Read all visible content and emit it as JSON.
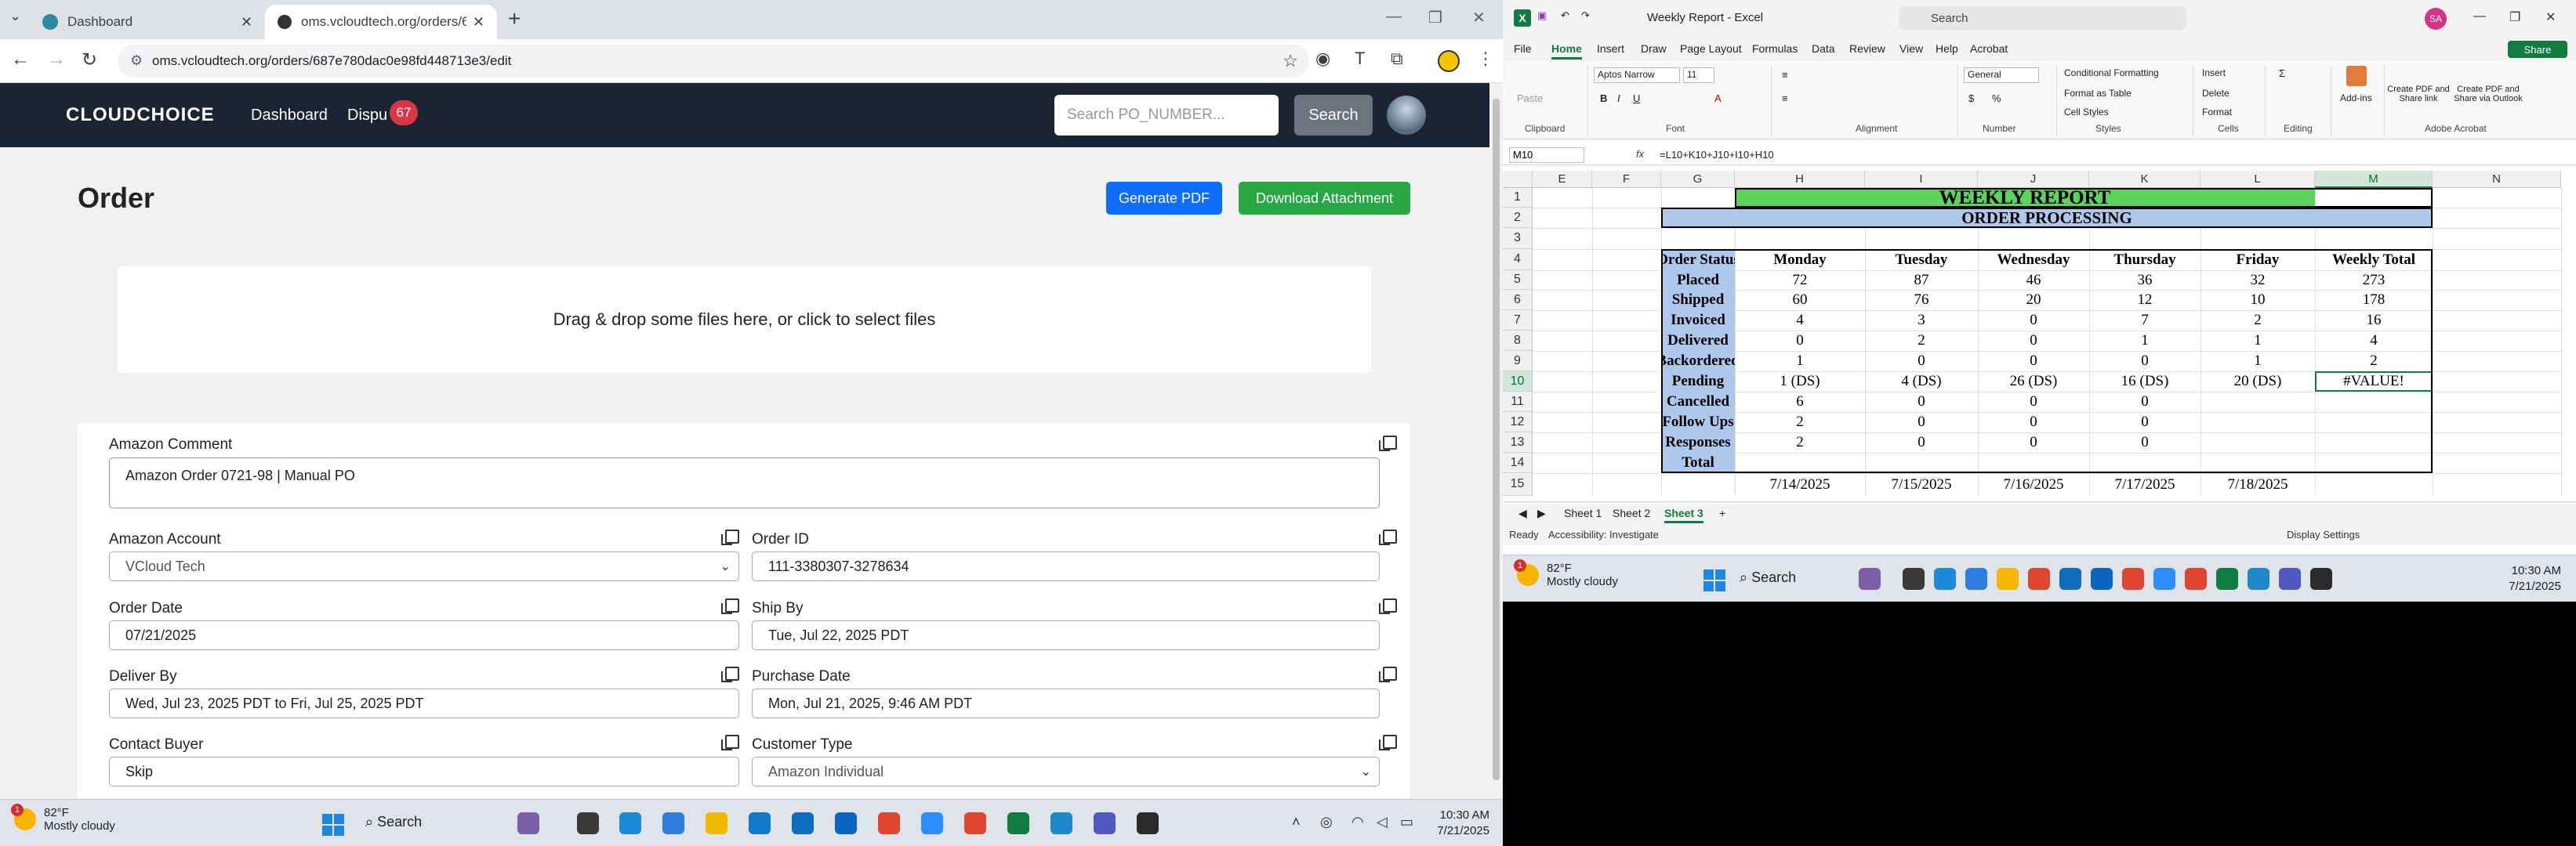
{
  "browser": {
    "tabs": [
      {
        "title": "Dashboard",
        "active": false
      },
      {
        "title": "oms.vcloudtech.org/orders/687",
        "active": true
      }
    ],
    "url": "oms.vcloudtech.org/orders/687e780dac0e98fd448713e3/edit"
  },
  "site": {
    "logo": "CLOUDCHOICE",
    "nav": {
      "dashboard": "Dashboard",
      "disputes": "Dispu",
      "disputes_count": "67"
    },
    "search_placeholder": "Search PO_NUMBER...",
    "search_button": "Search",
    "page_title": "Order",
    "generate_pdf": "Generate PDF",
    "download_attachment": "Download Attachment",
    "dropzone_text": "Drag & drop some files here, or click to select files",
    "form": {
      "amazon_comment_label": "Amazon Comment",
      "amazon_comment_value": "Amazon Order 0721-98 | Manual PO",
      "amazon_account_label": "Amazon Account",
      "amazon_account_value": "VCloud Tech",
      "order_id_label": "Order ID",
      "order_id_value": "111-3380307-3278634",
      "order_date_label": "Order Date",
      "order_date_value": "07/21/2025",
      "ship_by_label": "Ship By",
      "ship_by_value": "Tue, Jul 22, 2025 PDT",
      "deliver_by_label": "Deliver By",
      "deliver_by_value": "Wed, Jul 23, 2025 PDT to Fri, Jul 25, 2025 PDT",
      "purchase_date_label": "Purchase Date",
      "purchase_date_value": "Mon, Jul 21, 2025, 9:46 AM PDT",
      "contact_buyer_label": "Contact Buyer",
      "contact_buyer_value": "Skip",
      "customer_type_label": "Customer Type",
      "customer_type_value": "Amazon Individual"
    }
  },
  "taskbar_left": {
    "weather_temp": "82°F",
    "weather_desc": "Mostly cloudy",
    "weather_badge": "1",
    "search": "Search",
    "time": "10:30 AM",
    "date": "7/21/2025"
  },
  "excel": {
    "title": "Weekly Report - Excel",
    "search": "Search",
    "user_initials": "SA",
    "share": "Share",
    "menu": [
      "File",
      "Home",
      "Insert",
      "Draw",
      "Page Layout",
      "Formulas",
      "Data",
      "Review",
      "View",
      "Help",
      "Acrobat"
    ],
    "ribbon": {
      "paste": "Paste",
      "clipboard": "Clipboard",
      "font_name": "Aptos Narrow",
      "font_size": "11",
      "font": "Font",
      "alignment": "Alignment",
      "number_format": "General",
      "number": "Number",
      "conditional_formatting": "Conditional Formatting",
      "format_as_table": "Format as Table",
      "cell_styles": "Cell Styles",
      "styles": "Styles",
      "insert": "Insert",
      "delete": "Delete",
      "format": "Format",
      "cells": "Cells",
      "editing": "Editing",
      "add_ins": "Add-ins",
      "create_pdf_share_link": "Create PDF and Share link",
      "create_pdf_outlook": "Create PDF and Share via Outlook",
      "adobe_acrobat": "Adobe Acrobat"
    },
    "name_box": "M10",
    "formula": "=L10+K10+J10+I10+H10",
    "columns": [
      "E",
      "F",
      "G",
      "H",
      "I",
      "J",
      "K",
      "L",
      "M",
      "N"
    ],
    "rows": [
      "1",
      "2",
      "3",
      "4",
      "5",
      "6",
      "7",
      "8",
      "9",
      "10",
      "11",
      "12",
      "13",
      "14",
      "15"
    ],
    "report_title": "WEEKLY REPORT",
    "report_subtitle": "ORDER PROCESSING",
    "table_headers": [
      "Order Status",
      "Monday",
      "Tuesday",
      "Wednesday",
      "Thursday",
      "Friday",
      "Weekly Total"
    ],
    "table_rows": [
      [
        "Placed",
        "72",
        "87",
        "46",
        "36",
        "32",
        "273"
      ],
      [
        "Shipped",
        "60",
        "76",
        "20",
        "12",
        "10",
        "178"
      ],
      [
        "Invoiced",
        "4",
        "3",
        "0",
        "7",
        "2",
        "16"
      ],
      [
        "Delivered",
        "0",
        "2",
        "0",
        "1",
        "1",
        "4"
      ],
      [
        "Backordered",
        "1",
        "0",
        "0",
        "0",
        "1",
        "2"
      ],
      [
        "Pending",
        "1 (DS)",
        "4 (DS)",
        "26 (DS)",
        "16 (DS)",
        "20 (DS)",
        "#VALUE!"
      ],
      [
        "Cancelled",
        "6",
        "0",
        "0",
        "0",
        "",
        ""
      ],
      [
        "Follow Ups",
        "2",
        "0",
        "0",
        "0",
        "",
        ""
      ],
      [
        "Responses",
        "2",
        "0",
        "0",
        "0",
        "",
        ""
      ],
      [
        "Total",
        "",
        "",
        "",
        "",
        "",
        ""
      ]
    ],
    "row15": [
      "7/14/2025",
      "7/15/2025",
      "7/16/2025",
      "7/17/2025",
      "7/18/2025"
    ],
    "sheets": [
      "Sheet 1",
      "Sheet 2",
      "Sheet 3"
    ],
    "status_ready": "Ready",
    "accessibility": "Accessibility: Investigate",
    "display_settings": "Display Settings",
    "colors": {
      "title_green": "#5dd35d",
      "header_blue": "#aec8ec"
    }
  },
  "taskbar_right": {
    "weather_temp": "82°F",
    "weather_desc": "Mostly cloudy",
    "weather_badge": "1",
    "search": "Search",
    "time": "10:30 AM",
    "date": "7/21/2025"
  }
}
